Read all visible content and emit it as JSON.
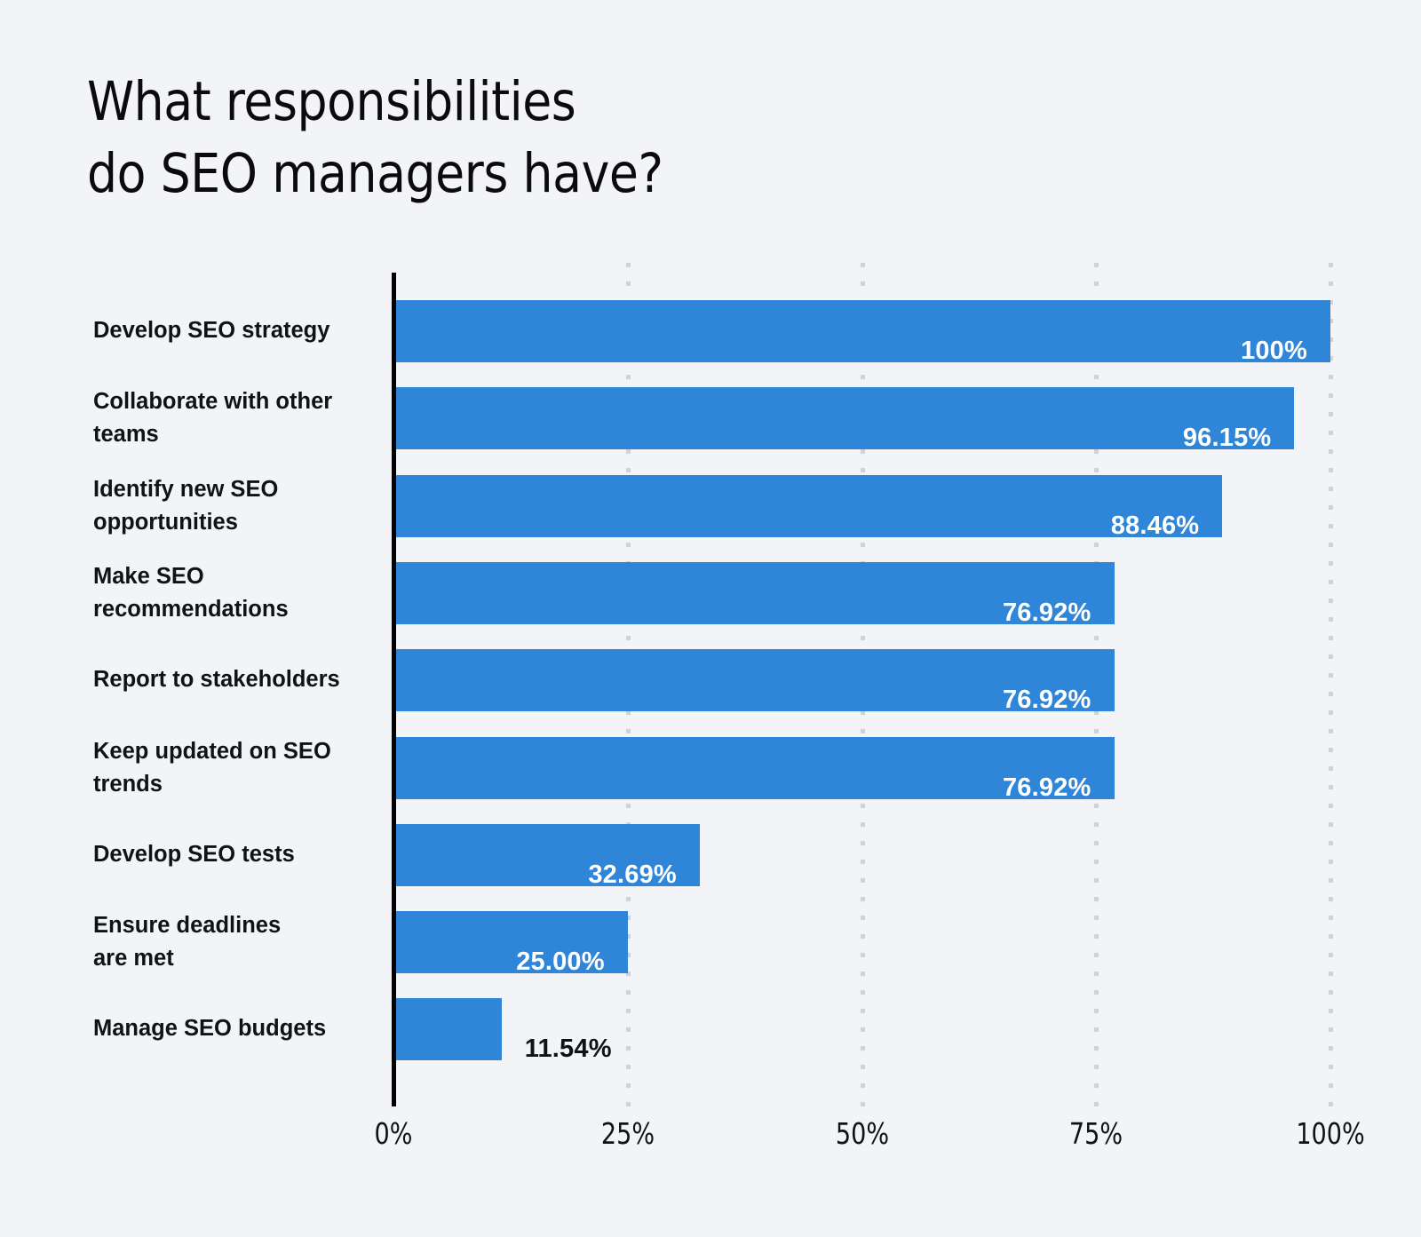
{
  "chart_data": {
    "type": "bar",
    "orientation": "horizontal",
    "title": "What responsibilities\ndo SEO managers have?",
    "title_line1": "What responsibilities",
    "title_line2": "do SEO managers have?",
    "xlabel": "",
    "ylabel": "",
    "xlim": [
      0,
      100
    ],
    "grid": true,
    "grid_axis": "x",
    "legend": false,
    "bar_color": "#2f86d8",
    "background_color": "#f2f4f7",
    "text_color": "#111214",
    "inside_label_color": "#ffffff",
    "x_tick_labels": [
      "0%",
      "25%",
      "50%",
      "75%",
      "100%"
    ],
    "x_tick_values": [
      0,
      25,
      50,
      75,
      100
    ],
    "categories": [
      "Develop SEO strategy",
      "Collaborate with other teams",
      "Identify new SEO opportunities",
      "Make SEO recommendations",
      "Report to stakeholders",
      "Keep updated on SEO trends",
      "Develop SEO tests",
      "Ensure deadlines are met",
      "Manage SEO budgets"
    ],
    "values": [
      100,
      96.15,
      88.46,
      76.92,
      76.92,
      76.92,
      32.69,
      25.0,
      11.54
    ],
    "value_labels": [
      "100%",
      "96.15%",
      "88.46%",
      "76.92%",
      "76.92%",
      "76.92%",
      "32.69%",
      "25.00%",
      "11.54%"
    ],
    "bars": [
      {
        "category": "Develop SEO strategy",
        "label_line1": "Develop SEO strategy",
        "label_line2": "",
        "value": 100,
        "value_label": "100%",
        "label_placement": "inside"
      },
      {
        "category": "Collaborate with other teams",
        "label_line1": "Collaborate with other",
        "label_line2": "teams",
        "value": 96.15,
        "value_label": "96.15%",
        "label_placement": "inside"
      },
      {
        "category": "Identify new SEO opportunities",
        "label_line1": "Identify new SEO",
        "label_line2": "opportunities",
        "value": 88.46,
        "value_label": "88.46%",
        "label_placement": "inside"
      },
      {
        "category": "Make SEO recommendations",
        "label_line1": "Make SEO",
        "label_line2": "recommendations",
        "value": 76.92,
        "value_label": "76.92%",
        "label_placement": "inside"
      },
      {
        "category": "Report to stakeholders",
        "label_line1": "Report to stakeholders",
        "label_line2": "",
        "value": 76.92,
        "value_label": "76.92%",
        "label_placement": "inside"
      },
      {
        "category": "Keep updated on SEO trends",
        "label_line1": "Keep updated on SEO",
        "label_line2": "trends",
        "value": 76.92,
        "value_label": "76.92%",
        "label_placement": "inside"
      },
      {
        "category": "Develop SEO tests",
        "label_line1": "Develop SEO tests",
        "label_line2": "",
        "value": 32.69,
        "value_label": "32.69%",
        "label_placement": "inside"
      },
      {
        "category": "Ensure deadlines are met",
        "label_line1": "Ensure deadlines",
        "label_line2": "are met",
        "value": 25.0,
        "value_label": "25.00%",
        "label_placement": "inside"
      },
      {
        "category": "Manage SEO budgets",
        "label_line1": "Manage SEO budgets",
        "label_line2": "",
        "value": 11.54,
        "value_label": "11.54%",
        "label_placement": "outside"
      }
    ]
  }
}
